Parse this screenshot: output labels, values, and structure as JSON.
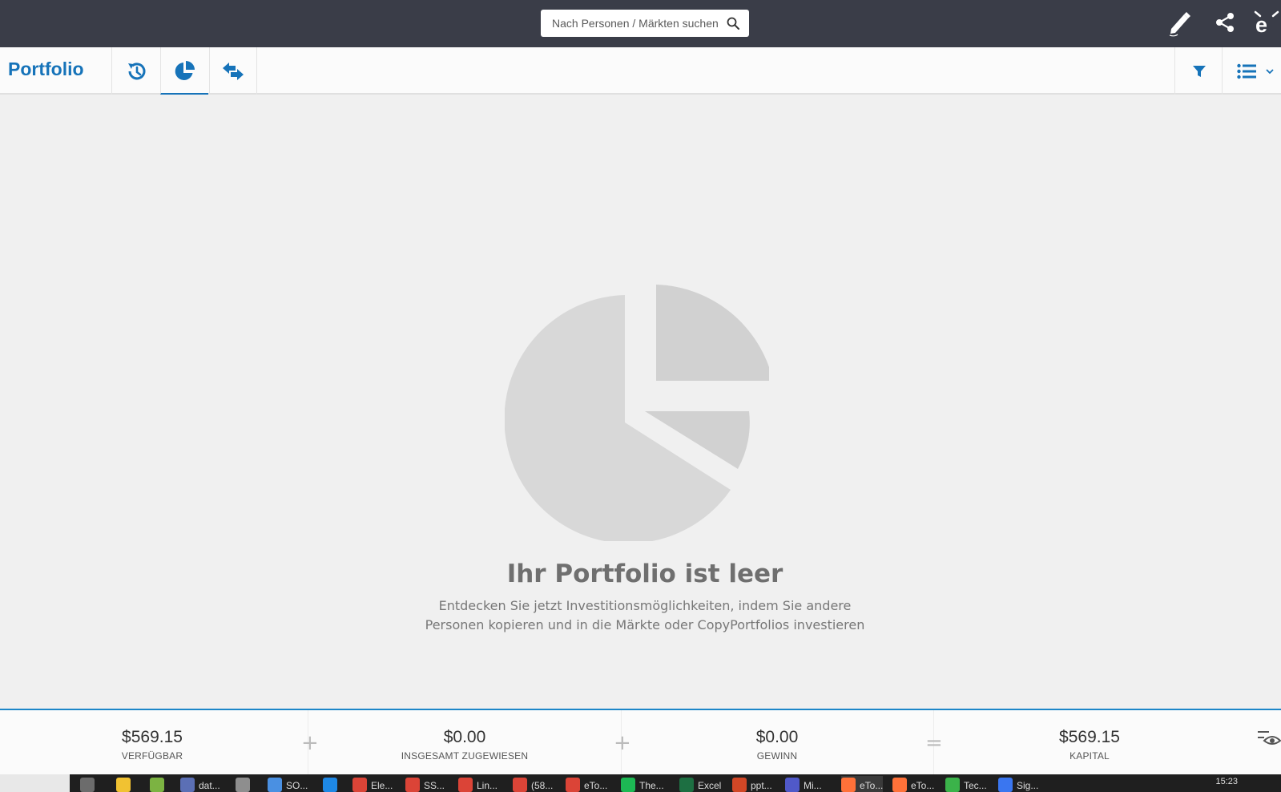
{
  "topbar": {
    "search": {
      "placeholder": "Nach Personen / Märkten suchen"
    },
    "icons": [
      "edit-icon",
      "share-icon",
      "etoro-logo-icon"
    ]
  },
  "subheader": {
    "title": "Portfolio",
    "tabs": [
      {
        "name": "history",
        "icon": "history-icon",
        "active": false
      },
      {
        "name": "allocation",
        "icon": "pie-chart-icon",
        "active": true
      },
      {
        "name": "transfers",
        "icon": "arrows-swap-icon",
        "active": false
      }
    ],
    "right_icons": [
      "filter-icon",
      "list-view-icon"
    ]
  },
  "empty_state": {
    "title": "Ihr Portfolio ist leer",
    "line1": "Entdecken Sie jetzt Investitionsmöglichkeiten, indem Sie andere",
    "line2": "Personen kopieren und in die Märkte oder CopyPortfolios investieren"
  },
  "footer": {
    "stats": [
      {
        "value": "$569.15",
        "label": "VERFÜGBAR"
      },
      {
        "value": "$0.00",
        "label": "INSGESAMT ZUGEWIESEN"
      },
      {
        "value": "$0.00",
        "label": "GEWINN"
      },
      {
        "value": "$569.15",
        "label": "KAPITAL"
      }
    ],
    "operators": [
      "+",
      "+",
      "="
    ]
  },
  "taskbar": {
    "items": [
      {
        "label": "",
        "color": "#6c6c6c"
      },
      {
        "label": "",
        "color": "#f1c232"
      },
      {
        "label": "",
        "color": "#7cb342"
      },
      {
        "label": "dat...",
        "color": "#5b6fb5"
      },
      {
        "label": "",
        "color": "#8e8e8e"
      },
      {
        "label": "SO...",
        "color": "#4a90e2"
      },
      {
        "label": "",
        "color": "#1e88e5"
      },
      {
        "label": "Ele...",
        "color": "#db4437"
      },
      {
        "label": "SS...",
        "color": "#db4437"
      },
      {
        "label": "Lin...",
        "color": "#db4437"
      },
      {
        "label": "(58...",
        "color": "#db4437"
      },
      {
        "label": "eTo...",
        "color": "#db4437"
      },
      {
        "label": "The...",
        "color": "#1db954"
      },
      {
        "label": "Excel",
        "color": "#1d6f42"
      },
      {
        "label": "ppt...",
        "color": "#d24726"
      },
      {
        "label": "Mi...",
        "color": "#5059c9"
      },
      {
        "label": "eTo...",
        "color": "#ff7139"
      },
      {
        "label": "eTo...",
        "color": "#ff7139"
      },
      {
        "label": "Tec...",
        "color": "#3bb34a"
      },
      {
        "label": "Sig...",
        "color": "#3a76f0"
      }
    ],
    "clock": "15:23"
  }
}
